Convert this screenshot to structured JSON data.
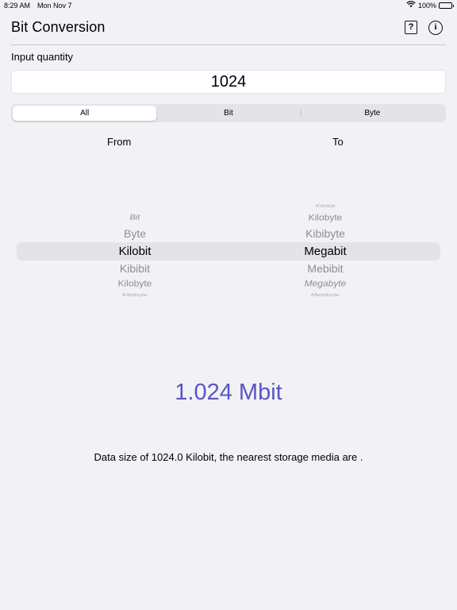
{
  "status_bar": {
    "time": "8:29 AM",
    "date": "Mon Nov 7",
    "battery": "100%",
    "wifi_icon": "wifi-icon",
    "battery_icon": "battery-icon"
  },
  "nav": {
    "title": "Bit Conversion",
    "help_icon": "question-square-icon",
    "info_icon": "info-circle-icon",
    "help_glyph": "?",
    "info_glyph": "i"
  },
  "input": {
    "label": "Input quantity",
    "value": "1024"
  },
  "segments": {
    "items": [
      "All",
      "Bit",
      "Byte"
    ],
    "selected": "All"
  },
  "picker": {
    "from_label": "From",
    "to_label": "To",
    "from_items": [
      "Bit",
      "Byte",
      "Kilobit",
      "Kibibit",
      "Kilobyte",
      "Kibibyte"
    ],
    "from_selected": "Kilobit",
    "to_items": [
      "Kibibit",
      "Kilobyte",
      "Kibibyte",
      "Megabit",
      "Mebibit",
      "Megabyte",
      "Mebibyte"
    ],
    "to_selected": "Megabit"
  },
  "result": {
    "value": "1.024 Mbit",
    "description": "Data size of 1024.0 Kilobit, the nearest storage media are  ."
  },
  "colors": {
    "accent": "#5b55c1",
    "background": "#f2f1f6"
  }
}
